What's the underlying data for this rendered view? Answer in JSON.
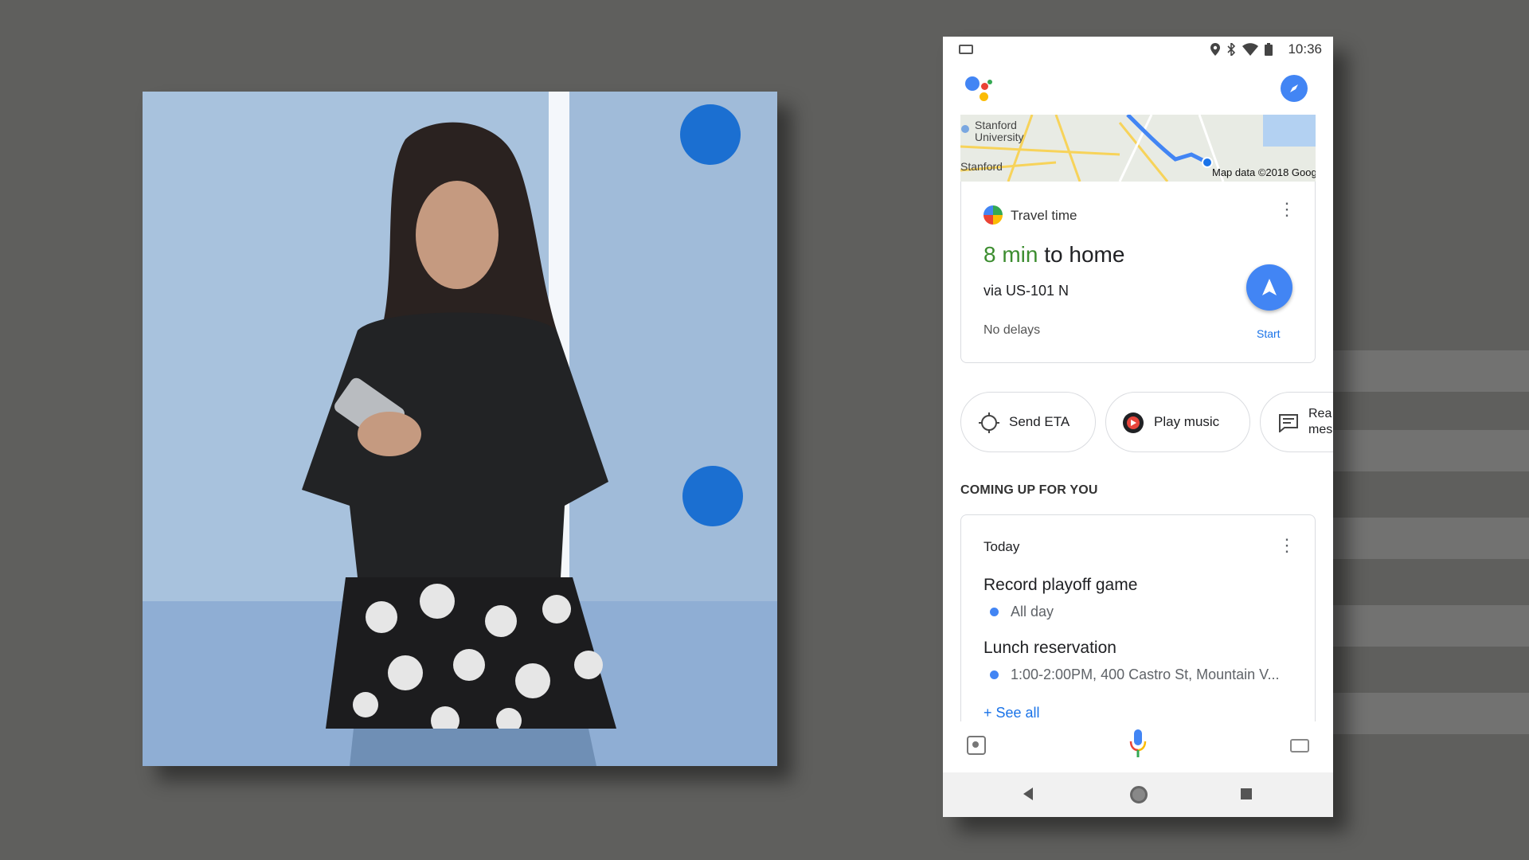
{
  "status_bar": {
    "time": "10:36",
    "icons": [
      "location-icon",
      "bluetooth-icon",
      "wifi-icon",
      "battery-icon"
    ]
  },
  "map": {
    "labels": [
      "Stanford University",
      "Stanford"
    ],
    "credit": "Map data ©2018 Goog"
  },
  "travel_card": {
    "title": "Travel time",
    "minutes": "8 min",
    "destination": "to home",
    "route": "via US-101 N",
    "status": "No delays",
    "start_label": "Start"
  },
  "chips": [
    {
      "label": "Send ETA",
      "icon": "target-icon"
    },
    {
      "label": "Play music",
      "icon": "music-icon"
    },
    {
      "label": "Rea mes",
      "icon": "message-icon"
    }
  ],
  "section": {
    "heading": "COMING UP FOR YOU"
  },
  "today_card": {
    "label": "Today",
    "events": [
      {
        "title": "Record playoff game",
        "detail": "All day"
      },
      {
        "title": "Lunch reservation",
        "detail": "1:00-2:00PM, 400 Castro St, Mountain V..."
      }
    ],
    "see_all": "+ See all"
  },
  "colors": {
    "accent": "#4285f4",
    "travel_minutes": "#3c8d2f",
    "link": "#1a73e8",
    "background": "#5f5f5d"
  }
}
